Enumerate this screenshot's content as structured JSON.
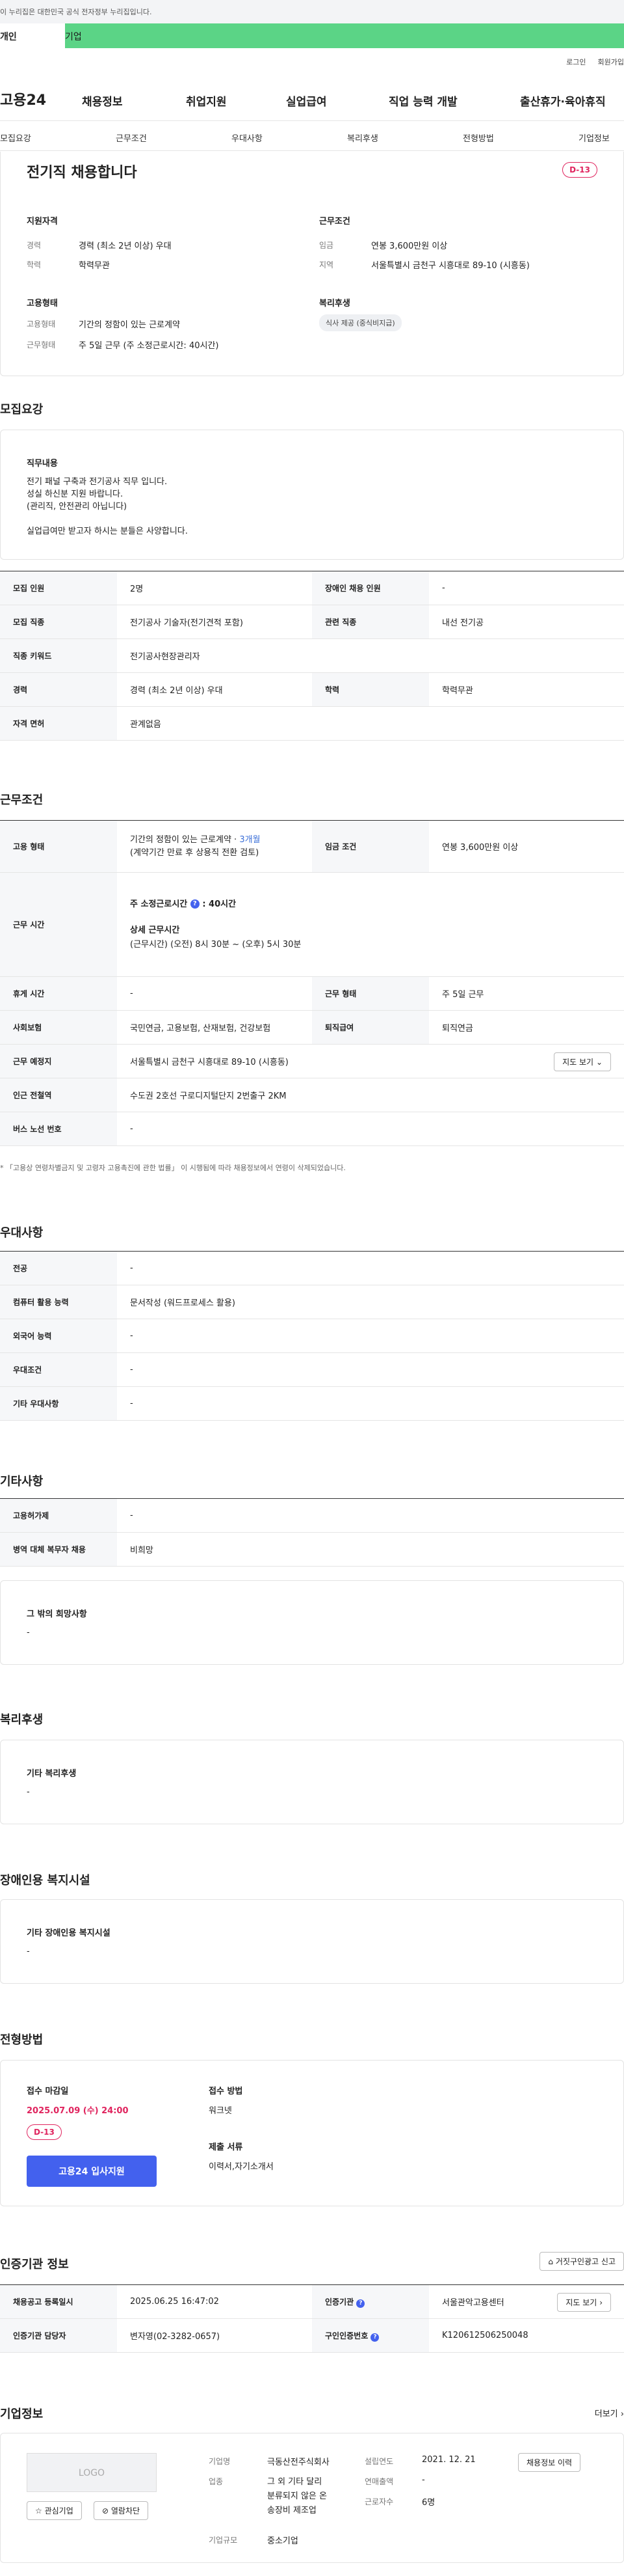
{
  "gov_bar": "이 누리집은 대한민국 공식 전자정부 누리집입니다.",
  "tabs": {
    "personal": "개인",
    "company": "기업"
  },
  "util": {
    "login": "로그인",
    "join": "회원가입"
  },
  "gnb": {
    "logo": "고용24",
    "items": [
      "채용정보",
      "취업지원",
      "실업급여",
      "직업 능력 개발",
      "출산휴가·육아휴직"
    ]
  },
  "snb": [
    "모집요강",
    "근무조건",
    "우대사항",
    "복리후생",
    "전형방법",
    "기업정보"
  ],
  "summary": {
    "title": "전기직 채용합니다",
    "dday": "D-13",
    "qual_h": "지원자격",
    "career_k": "경력",
    "career_v": "경력 (최소 2년 이상) 우대",
    "edu_k": "학력",
    "edu_v": "학력무관",
    "emp_h": "고용형태",
    "emp_type_k": "고용형태",
    "emp_type_v": "기간의 정함이 있는 근로계약",
    "work_type_k": "근무형태",
    "work_type_v": "주 5일 근무 (주 소정근로시간: 40시간)",
    "cond_h": "근무조건",
    "wage_k": "임금",
    "wage_v": "연봉 3,600만원 이상",
    "region_k": "지역",
    "region_v": "서울특별시 금천구 시흥대로 89-10 (시흥동)",
    "welfare_h": "복리후생",
    "welfare_chip": "식사 제공 (중식비지급)"
  },
  "recruit": {
    "section": "모집요강",
    "duty_h": "직무내용",
    "duty_lines": [
      "전기 패널 구축과 전기공사 직무 입니다.",
      "성실 하신분 지원 바랍니다.",
      "(관리직, 안전관리 아닙니다)",
      "",
      "실업급여만 받고자 하시는 분들은 사양합니다."
    ],
    "rows": [
      [
        "모집 인원",
        "2명",
        "장애인 채용 인원",
        "-"
      ],
      [
        "모집 직종",
        "전기공사 기술자(전기견적 포함)",
        "관련 직종",
        "내선 전기공"
      ],
      [
        "직종 키워드",
        "전기공사현장관리자",
        "",
        ""
      ],
      [
        "경력",
        "경력 (최소 2년 이상) 우대",
        "학력",
        "학력무관"
      ],
      [
        "자격 면허",
        "관계없음",
        "",
        ""
      ]
    ]
  },
  "work": {
    "section": "근무조건",
    "emp_k": "고용 형태",
    "emp_v1": "기간의 정함이 있는 근로계약 · ",
    "emp_link": "3개월",
    "emp_v2": "(계약기간 만료 후 상용직 전환 검토)",
    "wage_k": "임금 조건",
    "wage_v": "연봉 3,600만원 이상",
    "hours_k": "근무 시간",
    "hours_h1": "주 소정근로시간",
    "hours_v1": ": 40시간",
    "hours_h2": "상세 근무시간",
    "hours_v2": "(근무시간) (오전) 8시 30분 ~ (오후) 5시 30분",
    "rest_k": "휴게 시간",
    "rest_v": "-",
    "form_k": "근무 형태",
    "form_v": "주 5일 근무",
    "ins_k": "사회보험",
    "ins_v": "국민연금, 고용보험, 산재보험, 건강보험",
    "sev_k": "퇴직급여",
    "sev_v": "퇴직연금",
    "loc_k": "근무 예정지",
    "loc_v": "서울특별시 금천구 시흥대로 89-10 (시흥동)",
    "map_btn": "지도 보기",
    "sub_k": "인근 전철역",
    "sub_v": "수도권 2호선 구로디지털단지 2번출구 2KM",
    "bus_k": "버스 노선 번호",
    "bus_v": "-",
    "note": "「고용상 연령차별금지 및 고령자 고용촉진에 관한 법률」 이 시행됨에 따라 채용정보에서 연령이 삭제되었습니다."
  },
  "pref": {
    "section": "우대사항",
    "rows": [
      [
        "전공",
        "-"
      ],
      [
        "컴퓨터 활용 능력",
        "문서작성 (워드프로세스 활용)"
      ],
      [
        "외국어 능력",
        "-"
      ],
      [
        "우대조건",
        "-"
      ],
      [
        "기타 우대사항",
        "-"
      ]
    ]
  },
  "etc": {
    "section": "기타사항",
    "rows": [
      [
        "고용허가제",
        "-"
      ],
      [
        "병역 대체 복무자 채용",
        "비희망"
      ]
    ],
    "hope_h": "그 밖의 희망사항",
    "hope_v": "-"
  },
  "welfare": {
    "section": "복리후생",
    "h": "기타 복리후생",
    "v": "-"
  },
  "disabled": {
    "section": "장애인용 복지시설",
    "h": "기타 장애인용 복지시설",
    "v": "-"
  },
  "process": {
    "section": "전형방법",
    "deadline_h": "접수 마감일",
    "deadline_v": "2025.07.09 (수) 24:00",
    "dday": "D-13",
    "apply_btn": "고용24 입사지원",
    "method_h": "접수 방법",
    "method_v": "워크넷",
    "docs_h": "제출 서류",
    "docs_v": "이력서,자기소개서"
  },
  "agency": {
    "section": "인증기관 정보",
    "report_btn": "거짓구인광고 신고",
    "reg_k": "채용공고 등록일시",
    "reg_v": "2025.06.25 16:47:02",
    "org_k": "인증기관",
    "org_v": "서울관악고용센터",
    "map_btn": "지도 보기",
    "mgr_k": "인증기관 담당자",
    "mgr_v": "변자영(02-3282-0657)",
    "num_k": "구인인증번호",
    "num_v": "K120612506250048"
  },
  "company": {
    "section": "기업정보",
    "more": "더보기",
    "logo": "LOGO",
    "fav_btn": "관심기업",
    "block_btn": "열람차단",
    "name_k": "기업명",
    "name_v": "극동산전주식회사",
    "ind_k": "업종",
    "ind_v": [
      "그 외 기타 달리",
      "분류되지 않은 온",
      "송장비 제조업"
    ],
    "size_k": "기업규모",
    "size_v": "중소기업",
    "year_k": "설립연도",
    "year_v": "2021. 12. 21",
    "sales_k": "연매출액",
    "sales_v": "-",
    "emp_k": "근로자수",
    "emp_v": "6명",
    "jobs_btn": "채용정보 이력"
  },
  "colors": {
    "accent": "#4361ee",
    "dday": "#e0245e",
    "green": "#5bd486"
  }
}
